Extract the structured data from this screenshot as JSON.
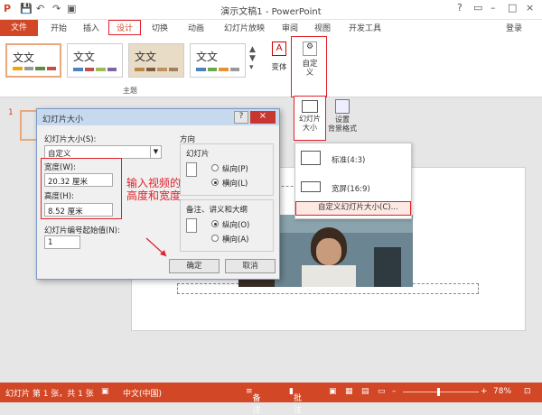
{
  "app": {
    "title": "演示文稿1 - PowerPoint",
    "login": "登录",
    "window_controls": [
      "?",
      "▭",
      "–",
      "□",
      "×"
    ]
  },
  "quick_access": [
    "💾",
    "↶",
    "↷",
    "▣"
  ],
  "tabs": [
    "文件",
    "开始",
    "插入",
    "设计",
    "切换",
    "动画",
    "幻灯片放映",
    "审阅",
    "视图",
    "开发工具"
  ],
  "ribbon": {
    "themes_group": "主题",
    "themes": [
      {
        "label": "文文",
        "colors": [
          "#f4a300",
          "#999",
          "#5f8d3f",
          "#c0504d"
        ]
      },
      {
        "label": "文文",
        "colors": [
          "#4f81bd",
          "#c0504d",
          "#9bbb59",
          "#8064a2"
        ]
      },
      {
        "label": "文文",
        "colors": [
          "#b68a4d",
          "#7f5f3b",
          "#c09060",
          "#a08060"
        ]
      },
      {
        "label": "文文",
        "colors": [
          "#4f81bd",
          "#6aa84f",
          "#e69138",
          "#999999"
        ]
      }
    ],
    "variant_label": "变体",
    "customize_label": "自定\n义",
    "slide_size_label": "幻灯片\n大小",
    "format_bg_label": "设置\n背景格式"
  },
  "slide_size_menu": {
    "items": [
      "标准(4:3)",
      "宽屏(16:9)",
      "自定义幻灯片大小(C)..."
    ]
  },
  "dialog": {
    "title": "幻灯片大小",
    "size_label": "幻灯片大小(S):",
    "size_value": "自定义",
    "width_label": "宽度(W):",
    "width_value": "20.32 厘米",
    "height_label": "高度(H):",
    "height_value": "8.52 厘米",
    "numbering_label": "幻灯片编号起始值(N):",
    "numbering_value": "1",
    "orientation_label": "方向",
    "slides_label": "幻灯片",
    "portrait": "纵向(P)",
    "landscape": "横向(L)",
    "notes_label": "备注、讲义和大纲",
    "notes_portrait": "纵向(O)",
    "notes_landscape": "横向(A)",
    "ok": "确定",
    "cancel": "取消",
    "help": "?",
    "close": "×"
  },
  "annotation": "输入视频的\n高度和宽度",
  "slide_thumb_number": "1",
  "status": {
    "slide_info": "幻灯片 第 1 张，共 1 张",
    "language": "中文(中国)",
    "notes": "备注",
    "comments": "批注",
    "zoom": "78%"
  }
}
